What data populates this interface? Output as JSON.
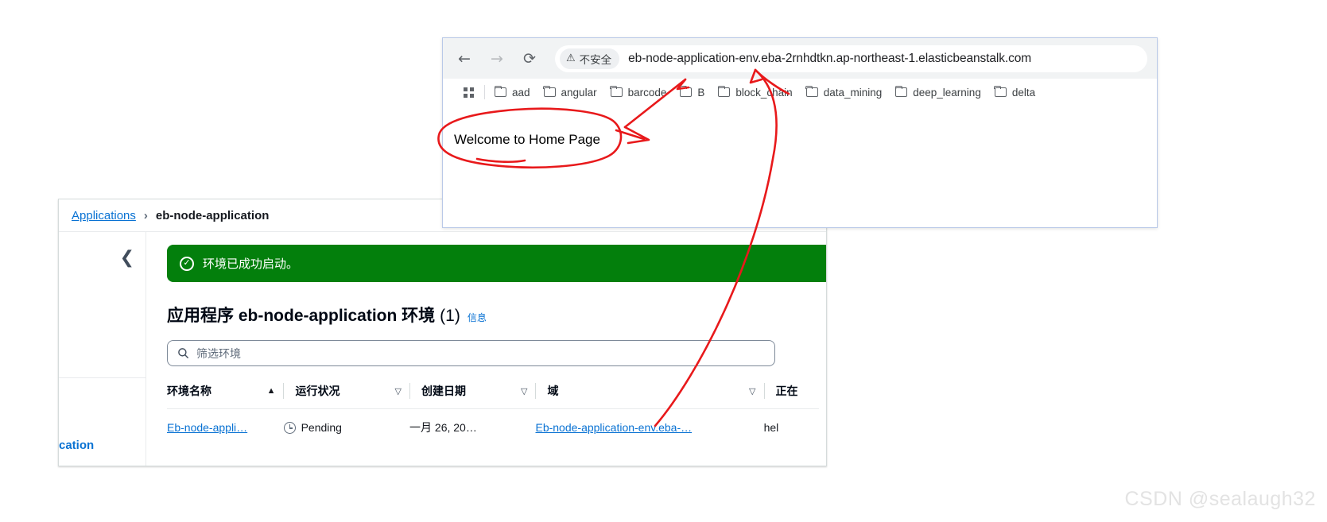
{
  "browser": {
    "nav": {
      "back_icon": "arrow-left",
      "forward_icon": "arrow-right",
      "reload_icon": "⟳"
    },
    "omnibox": {
      "security_label": "不安全",
      "security_icon": "warning-triangle",
      "url": "eb-node-application-env.eba-2rnhdtkn.ap-northeast-1.elasticbeanstalk.com"
    },
    "bookmarks": {
      "apps_icon": "apps-grid-icon",
      "items": [
        {
          "label": "aad"
        },
        {
          "label": "angular"
        },
        {
          "label": "barcode"
        },
        {
          "label": "B"
        },
        {
          "label": "block_chain"
        },
        {
          "label": "data_mining"
        },
        {
          "label": "deep_learning"
        },
        {
          "label": "delta"
        }
      ]
    },
    "page": {
      "body_text": "Welcome to Home Page"
    }
  },
  "aws": {
    "breadcrumb": {
      "root_label": "Applications",
      "separator": "›",
      "current_label": "eb-node-application"
    },
    "sidebar": {
      "collapse_icon": "chevron-left-icon",
      "app_link_label": "cation"
    },
    "flash": {
      "icon": "check-circle-icon",
      "message": "环境已成功启动。",
      "color": "#037f0c"
    },
    "title": {
      "main": "应用程序 eb-node-application 环境",
      "count": "(1)",
      "info_link": "信息"
    },
    "filter": {
      "icon": "search-icon",
      "placeholder": "筛选环境"
    },
    "table": {
      "columns": [
        {
          "label": "环境名称",
          "sort": "▲"
        },
        {
          "label": "运行状况",
          "sort": "▽"
        },
        {
          "label": "创建日期",
          "sort": "▽"
        },
        {
          "label": "域",
          "sort": "▽"
        },
        {
          "label": "正在"
        }
      ],
      "rows": [
        {
          "name": "Eb-node-appli…",
          "health": "Pending",
          "health_icon": "clock-icon",
          "created": "一月 26, 20…",
          "domain": "Eb-node-application-env.eba-…",
          "running": "hel"
        }
      ]
    }
  },
  "watermark": {
    "text": "CSDN @sealaugh32"
  },
  "annotation": {
    "color": "#e8191b"
  }
}
